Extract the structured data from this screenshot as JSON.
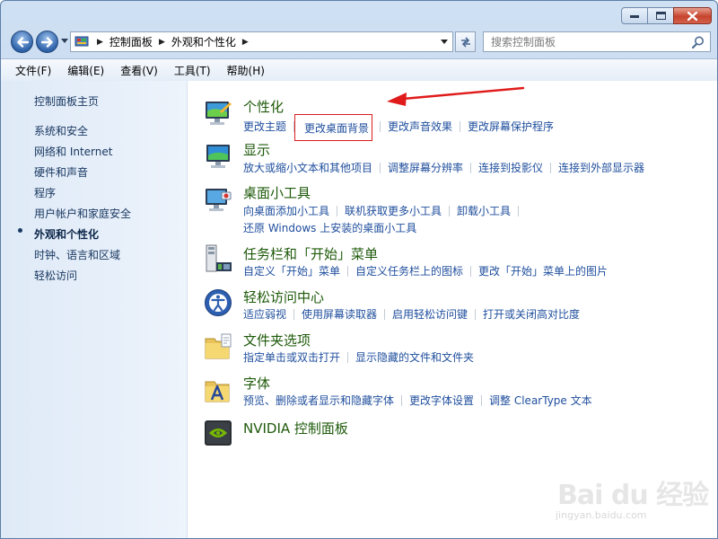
{
  "window": {
    "minimize_icon": "minimize-icon",
    "maximize_icon": "maximize-icon",
    "close_icon": "close-icon"
  },
  "address_bar": {
    "crumbs": [
      "控制面板",
      "外观和个性化"
    ],
    "search_placeholder": "搜索控制面板"
  },
  "menubar": {
    "items": [
      "文件(F)",
      "编辑(E)",
      "查看(V)",
      "工具(T)",
      "帮助(H)"
    ]
  },
  "sidebar": {
    "items": [
      "控制面板主页",
      "系统和安全",
      "网络和 Internet",
      "硬件和声音",
      "程序",
      "用户帐户和家庭安全",
      "外观和个性化",
      "时钟、语言和区域",
      "轻松访问"
    ],
    "current_index": 6
  },
  "categories": [
    {
      "title": "个性化",
      "icon": "personalization-icon",
      "tasks": [
        [
          "更改主题",
          "更改桌面背景",
          "更改声音效果",
          "更改屏幕保护程序"
        ]
      ]
    },
    {
      "title": "显示",
      "icon": "display-icon",
      "tasks": [
        [
          "放大或缩小文本和其他项目",
          "调整屏幕分辨率",
          "连接到投影仪",
          "连接到外部显示器"
        ]
      ]
    },
    {
      "title": "桌面小工具",
      "icon": "gadgets-icon",
      "tasks": [
        [
          "向桌面添加小工具",
          "联机获取更多小工具",
          "卸载小工具"
        ],
        [
          "还原 Windows 上安装的桌面小工具"
        ]
      ]
    },
    {
      "title": "任务栏和「开始」菜单",
      "icon": "taskbar-icon",
      "tasks": [
        [
          "自定义「开始」菜单",
          "自定义任务栏上的图标",
          "更改「开始」菜单上的图片"
        ]
      ]
    },
    {
      "title": "轻松访问中心",
      "icon": "ease-of-access-icon",
      "tasks": [
        [
          "适应弱视",
          "使用屏幕读取器",
          "启用轻松访问键",
          "打开或关闭高对比度"
        ]
      ]
    },
    {
      "title": "文件夹选项",
      "icon": "folder-options-icon",
      "tasks": [
        [
          "指定单击或双击打开",
          "显示隐藏的文件和文件夹"
        ]
      ]
    },
    {
      "title": "字体",
      "icon": "fonts-icon",
      "tasks": [
        [
          "预览、删除或者显示和隐藏字体",
          "更改字体设置",
          "调整 ClearType 文本"
        ]
      ]
    },
    {
      "title": "NVIDIA 控制面板",
      "icon": "nvidia-icon",
      "tasks": []
    }
  ],
  "watermark": {
    "brand": "Bai du 经验",
    "url": "jingyan.baidu.com"
  },
  "colors": {
    "category_title": "#1e5a0a",
    "task_link": "#1f4e9d",
    "highlight": "#d81e1e",
    "sidebar_text": "#17365f"
  }
}
